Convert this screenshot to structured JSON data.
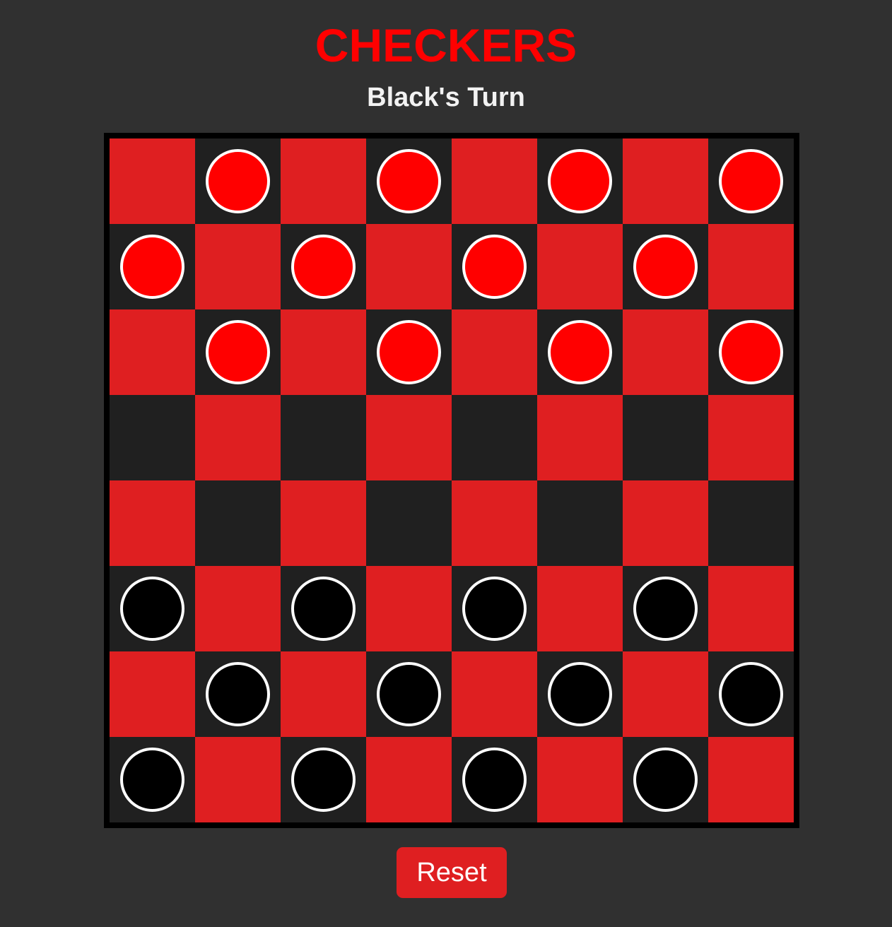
{
  "header": {
    "title": "CHECKERS",
    "turn_status": "Black's Turn"
  },
  "controls": {
    "reset_label": "Reset"
  },
  "colors": {
    "background": "#303030",
    "title": "#ff0000",
    "light_square": "#df1f21",
    "dark_square": "#202020",
    "red_piece": "#ff0000",
    "black_piece": "#000000",
    "piece_outline": "#ffffff",
    "board_frame": "#000000",
    "reset_button": "#df1f21"
  },
  "board": {
    "rows": 8,
    "cols": 8,
    "cells": [
      [
        ".",
        "r",
        ".",
        "r",
        ".",
        "r",
        ".",
        "r"
      ],
      [
        "r",
        ".",
        "r",
        ".",
        "r",
        ".",
        "r",
        "."
      ],
      [
        ".",
        "r",
        ".",
        "r",
        ".",
        "r",
        ".",
        "r"
      ],
      [
        ".",
        ".",
        ".",
        ".",
        ".",
        ".",
        ".",
        "."
      ],
      [
        ".",
        ".",
        ".",
        ".",
        ".",
        ".",
        ".",
        "."
      ],
      [
        "b",
        ".",
        "b",
        ".",
        "b",
        ".",
        "b",
        "."
      ],
      [
        ".",
        "b",
        ".",
        "b",
        ".",
        "b",
        ".",
        "b"
      ],
      [
        "b",
        ".",
        "b",
        ".",
        "b",
        ".",
        "b",
        "."
      ]
    ]
  }
}
